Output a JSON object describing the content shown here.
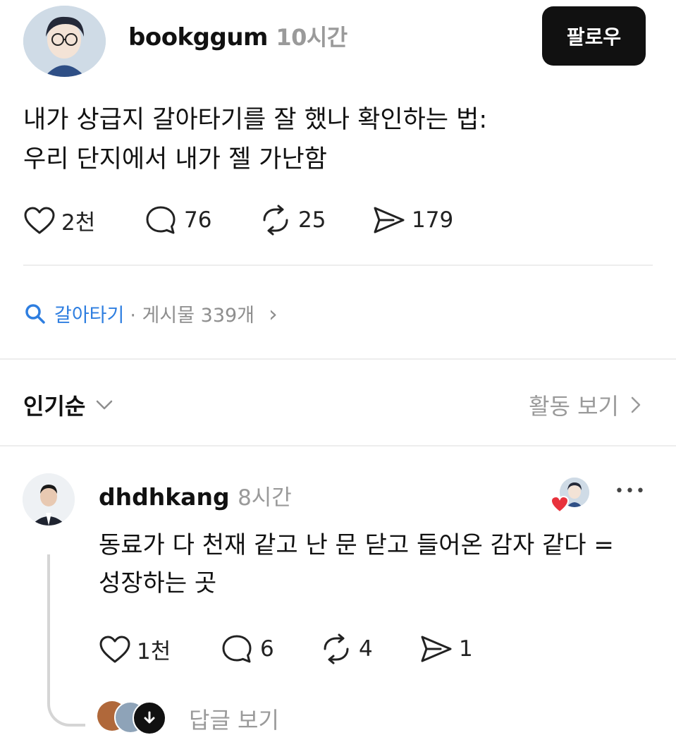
{
  "post": {
    "username": "bookggum",
    "time": "10시간",
    "follow_label": "팔로우",
    "text_line1": "내가 상급지 갈아타기를 잘 했나 확인하는 법:",
    "text_line2": "우리 단지에서 내가 젤 가난함",
    "likes": "2천",
    "comments": "76",
    "reposts": "25",
    "shares": "179"
  },
  "topic": {
    "name": "갈아타기",
    "meta": "· 게시물 339개",
    "chevron": "›"
  },
  "sort": {
    "label": "인기순",
    "activity_label": "활동 보기"
  },
  "comment": {
    "username": "dhdhkang",
    "time": "8시간",
    "more_label": "•••",
    "text_line1": "동료가 다 천재 같고 난 문 닫고 들어온 감자 같다 =",
    "text_line2": "성장하는 곳",
    "likes": "1천",
    "comments": "6",
    "reposts": "4",
    "shares": "1",
    "replies_label": "답글 보기"
  },
  "colors": {
    "accent_blue": "#2e7ee0",
    "heart_red": "#e8323c",
    "follow_bg": "#111111"
  }
}
